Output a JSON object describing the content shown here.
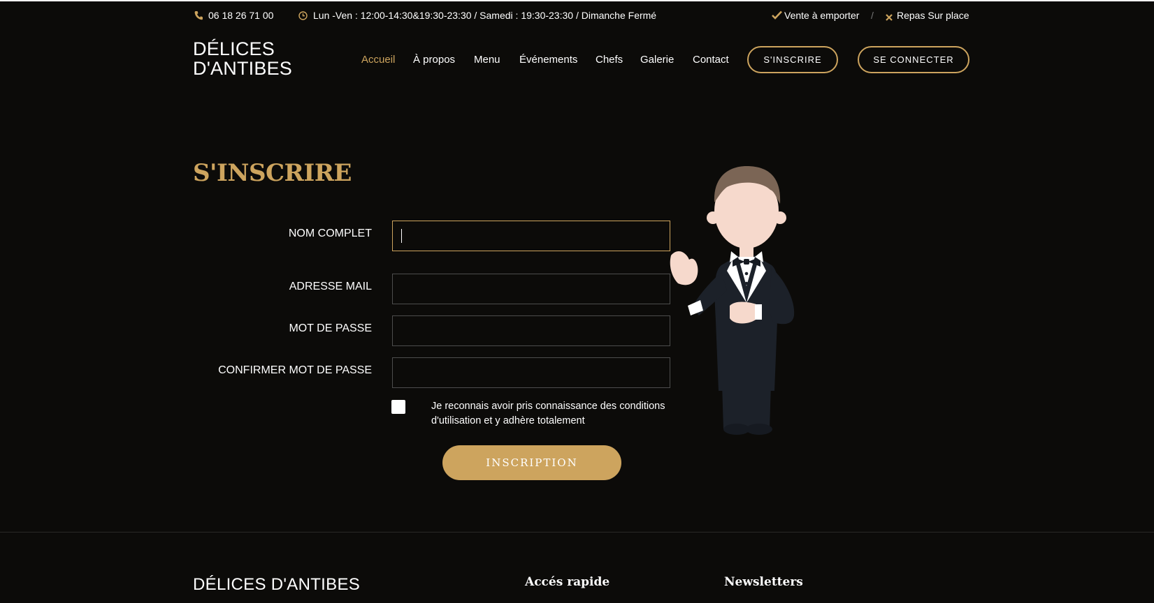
{
  "topbar": {
    "phone_icon": "phone-icon",
    "phone": "06 18 26 71 00",
    "clock_icon": "clock-icon",
    "hours": "Lun -Ven : 12:00-14:30&19:30-23:30 / Samedi : 19:30-23:30 / Dimanche Fermé",
    "check_icon": "checkmark-icon",
    "takeaway": "Vente à emporter",
    "separator": "/",
    "x_icon": "cross-icon",
    "dine_in": "Repas Sur place"
  },
  "header": {
    "logo_line1": "DÉLICES",
    "logo_line2": "D'ANTIBES",
    "nav": [
      {
        "label": "Accueil"
      },
      {
        "label": "À propos"
      },
      {
        "label": "Menu"
      },
      {
        "label": "Événements"
      },
      {
        "label": "Chefs"
      },
      {
        "label": "Galerie"
      },
      {
        "label": "Contact"
      }
    ],
    "signup_button": "S'INSCRIRE",
    "login_button": "SE CONNECTER"
  },
  "form": {
    "title": "S'INSCRIRE",
    "fields": [
      {
        "label": "NOM COMPLET",
        "value": ""
      },
      {
        "label": "ADRESSE MAIL",
        "value": ""
      },
      {
        "label": "MOT DE PASSE",
        "value": ""
      },
      {
        "label": "CONFIRMER MOT DE PASSE",
        "value": ""
      }
    ],
    "terms_line1": "Je reconnais avoir pris connaissance des conditions",
    "terms_line2": "d'utilisation et y adhère totalement",
    "terms_checked": false,
    "submit": "INSCRIPTION"
  },
  "footer": {
    "brand": "DÉLICES D'ANTIBES",
    "quick_access": "Accés rapide",
    "newsletters": "Newsletters"
  },
  "colors": {
    "background": "#0c0b09",
    "accent": "#cda45e",
    "text": "#ffffff"
  }
}
